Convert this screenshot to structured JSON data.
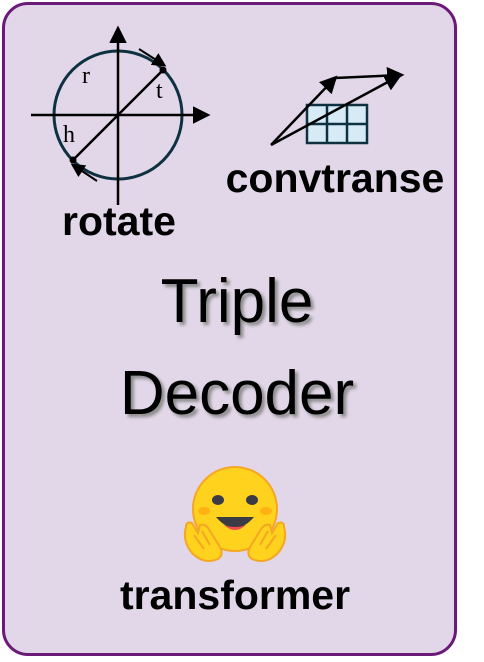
{
  "colors": {
    "card_background": "#e2d7e8",
    "card_border": "#6b1a78",
    "grid_fill": "#d6ebf5",
    "figure_stroke": "#000000"
  },
  "icons": {
    "rotate": "rotation-circle-diagram-icon",
    "convtranse": "convolution-grid-diagram-icon",
    "transformer": "hugging-face-emoji-icon"
  },
  "rotate": {
    "label": "rotate",
    "symbols": {
      "r": "r",
      "t": "t",
      "h": "h"
    }
  },
  "convtranse": {
    "label": "convtranse"
  },
  "title": {
    "line1": "Triple",
    "line2": "Decoder"
  },
  "transformer": {
    "label": "transformer"
  }
}
